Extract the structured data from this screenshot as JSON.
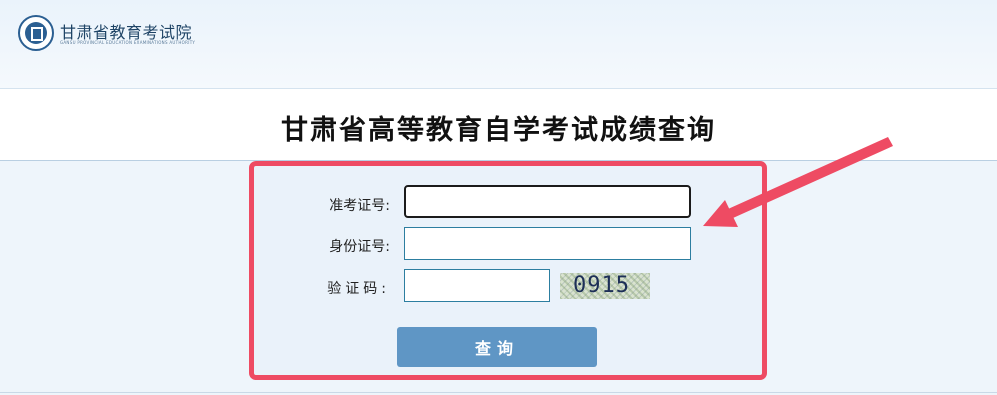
{
  "header": {
    "org_name": "甘肃省教育考试院",
    "org_subtitle": "GANSU PROVINCIAL EDUCATION EXAMINATIONS AUTHORITY"
  },
  "page": {
    "title": "甘肃省高等教育自学考试成绩查询"
  },
  "form": {
    "ticket_label": "准考证号:",
    "ticket_value": "",
    "id_label": "身份证号:",
    "id_value": "",
    "captcha_label": "验证码:",
    "captcha_value": "",
    "captcha_image_text": "0915",
    "submit_label": "查询"
  },
  "colors": {
    "highlight": "#ee4b63",
    "button": "#5f96c5",
    "logo": "#2b5f92"
  }
}
